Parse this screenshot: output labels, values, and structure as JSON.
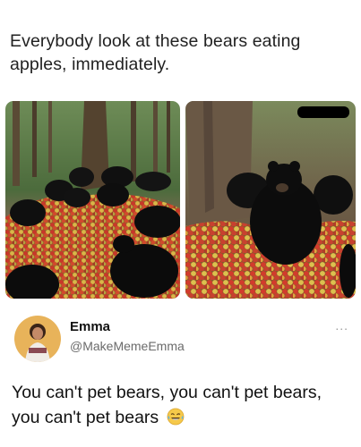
{
  "headline": "Everybody look at these bears eating apples, immediately.",
  "post": {
    "name": "Emma",
    "handle": "@MakeMemeEmma",
    "more_label": "...",
    "text": "You can't pet bears, you can't pet bears, you can't pet bears",
    "emoji": "laughing-crying-emoji"
  },
  "photos": [
    {
      "subject": "bears-eating-apples-forest-left"
    },
    {
      "subject": "bear-sitting-in-apples-right"
    }
  ],
  "colors": {
    "text": "#222222",
    "handle": "#6b6b6b",
    "apple_red": "#c8372a",
    "apple_yellow": "#d9b648",
    "bear": "#101010"
  }
}
